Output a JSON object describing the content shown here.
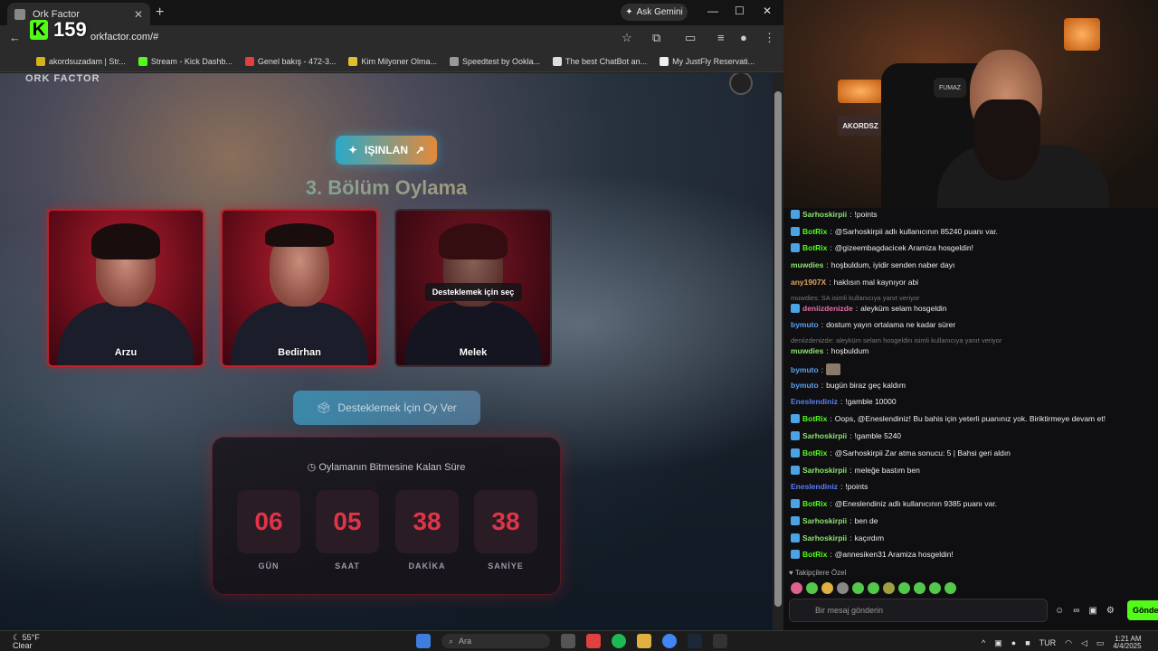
{
  "browser": {
    "tab_title": "Ork Factor",
    "tab_close": "✕",
    "new_tab": "+",
    "ask_gemini": "Ask Gemini",
    "url": "orkfactor.com/#",
    "bookmarks": [
      "akordsuzadam | Str...",
      "Stream - Kick Dashb...",
      "Genel bakış - 472-3...",
      "Kim Milyoner Olma...",
      "Speedtest by Ookla...",
      "The best ChatBot an...",
      "My JustFly Reservati..."
    ]
  },
  "overlay": {
    "viewer_count": "159"
  },
  "page": {
    "logo": "ORK FACTOR",
    "isinlan_button": "IŞINLAN",
    "title": "3. Bölüm Oylama",
    "candidates": [
      {
        "name": "Arzu"
      },
      {
        "name": "Bedirhan"
      },
      {
        "name": "Melek",
        "tooltip": "Desteklemek için seç"
      }
    ],
    "vote_button": "Desteklemek İçin Oy Ver",
    "timer": {
      "heading": "Oylamanın Bitmesine Kalan Süre",
      "units": [
        {
          "value": "06",
          "label": "GÜN"
        },
        {
          "value": "05",
          "label": "SAAT"
        },
        {
          "value": "38",
          "label": "DAKİKA"
        },
        {
          "value": "38",
          "label": "SANİYE"
        }
      ]
    }
  },
  "stream": {
    "chair_brand": "FUMAZ",
    "sign": "AKORDSZ"
  },
  "chat": {
    "messages": [
      {
        "user": "Sarhoskirpii",
        "text": "!points",
        "color": "#8be36f"
      },
      {
        "user": "BotRix",
        "text": "@Sarhoskirpii adlı kullanıcının 85240 puanı var.",
        "color": "#53fc18"
      },
      {
        "user": "BotRix",
        "text": "@gizeembagdacicek Aramiza hosgeldin!",
        "color": "#53fc18"
      },
      {
        "user": "muwdies",
        "text": "hoşbuldum, iyidir senden naber dayı",
        "color": "#8be36f"
      },
      {
        "user": "any1907X",
        "text": "haklısın mal kaynıyor abi",
        "color": "#e0a45c"
      },
      {
        "reply": "muwdies: SA isimli kullanıcıya yanıt veriyor"
      },
      {
        "user": "deniizdenizde",
        "text": "aleyküm selam hosgeldin",
        "color": "#e46fa6"
      },
      {
        "user": "bymuto",
        "text": "dostum yayın ortalama ne kadar sürer",
        "color": "#5aa0f0"
      },
      {
        "reply": "deniizdenizde: aleyküm selam hosgeldin isimli kullanıcıya yanıt veriyor"
      },
      {
        "user": "muwdies",
        "text": "hoşbuldum",
        "color": "#8be36f"
      },
      {
        "user": "bymuto",
        "text": "",
        "color": "#5aa0f0"
      },
      {
        "user": "bymuto",
        "text": "bugün biraz geç kaldım",
        "color": "#5aa0f0"
      },
      {
        "user": "Eneslendiniz",
        "text": "!gamble 10000",
        "color": "#5a7ef0"
      },
      {
        "user": "BotRix",
        "text": "Oops, @Eneslendiniz! Bu bahis için yeterli puanınız yok. Biriktirmeye devam et!",
        "color": "#53fc18"
      },
      {
        "user": "Sarhoskirpii",
        "text": "!gamble 5240",
        "color": "#8be36f"
      },
      {
        "user": "BotRix",
        "text": "@Sarhoskirpii Zar atma sonucu: 5 | Bahsi geri aldın",
        "color": "#53fc18"
      },
      {
        "user": "Sarhoskirpii",
        "text": "meleğe bastım ben",
        "color": "#8be36f"
      },
      {
        "user": "Eneslendiniz",
        "text": "!points",
        "color": "#5a7ef0"
      },
      {
        "user": "BotRix",
        "text": "@Eneslendiniz adlı kullanıcının 9385 puanı var.",
        "color": "#53fc18"
      },
      {
        "user": "Sarhoskirpii",
        "text": "ben de",
        "color": "#8be36f"
      },
      {
        "user": "Sarhoskirpii",
        "text": "kaçırdım",
        "color": "#8be36f"
      },
      {
        "user": "BotRix",
        "text": "@annesiken31 Aramiza hosgeldin!",
        "color": "#53fc18"
      }
    ],
    "followers_label": "Takipçilere Özel",
    "input_placeholder": "Bir mesaj gönderin",
    "send_button": "Gönde"
  },
  "taskbar": {
    "temp": "55°F",
    "weather": "Clear",
    "search": "Ara",
    "lang": "TUR",
    "time": "1:21 AM",
    "date": "4/4/2025"
  }
}
